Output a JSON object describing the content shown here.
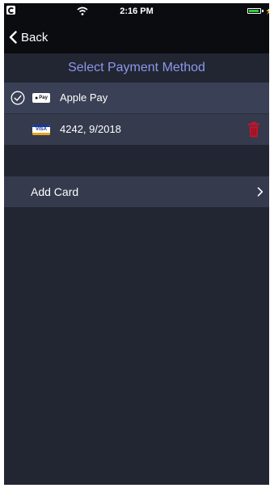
{
  "status_bar": {
    "time": "2:16 PM"
  },
  "nav": {
    "back_label": "Back"
  },
  "section": {
    "title": "Select Payment Method"
  },
  "payment_methods": [
    {
      "icon": "apple-pay-logo",
      "logo_text": "Pay",
      "label": "Apple Pay",
      "selected": true
    },
    {
      "icon": "visa-card-logo",
      "logo_text": "VISA",
      "label": "4242, 9/2018",
      "selected": false
    }
  ],
  "add_card": {
    "label": "Add Card"
  },
  "colors": {
    "accent": "#8d97e8",
    "delete": "#c0162e",
    "background": "#222633",
    "row": "#353a4d"
  }
}
